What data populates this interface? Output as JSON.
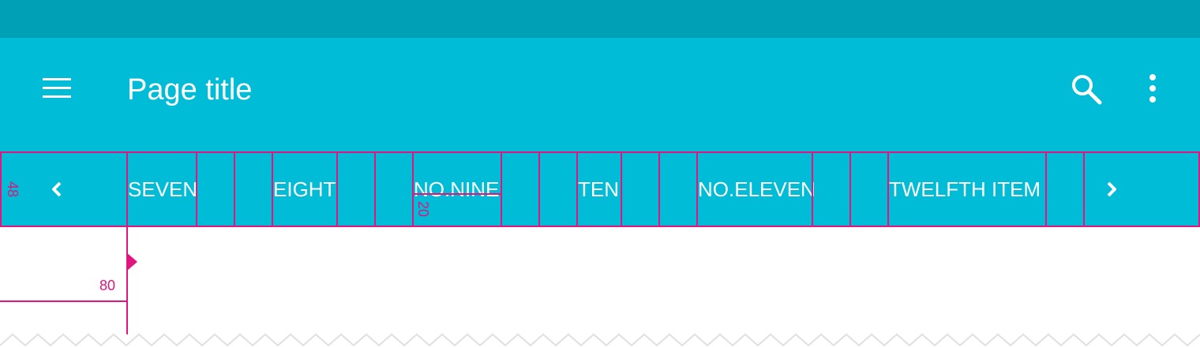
{
  "colors": {
    "status_bar": "#00a0b6",
    "primary": "#00bcd6",
    "redline": "#e0157f",
    "on_primary": "#ffffff"
  },
  "app_bar": {
    "title": "Page title",
    "nav_icon": "menu-icon",
    "actions": [
      {
        "icon": "search-icon"
      },
      {
        "icon": "more-vert-icon"
      }
    ]
  },
  "tabs": {
    "prev_icon": "chevron-left-icon",
    "next_icon": "chevron-right-icon",
    "items": [
      {
        "label": "SEVEN"
      },
      {
        "label": "EIGHT"
      },
      {
        "label": "NO.NINE"
      },
      {
        "label": "TEN"
      },
      {
        "label": "NO.ELEVEN"
      },
      {
        "label": "TWELFTH ITEM"
      }
    ]
  },
  "spec_annotations": {
    "tab_height": "48",
    "label_offset": "20",
    "content_inset": "80"
  }
}
